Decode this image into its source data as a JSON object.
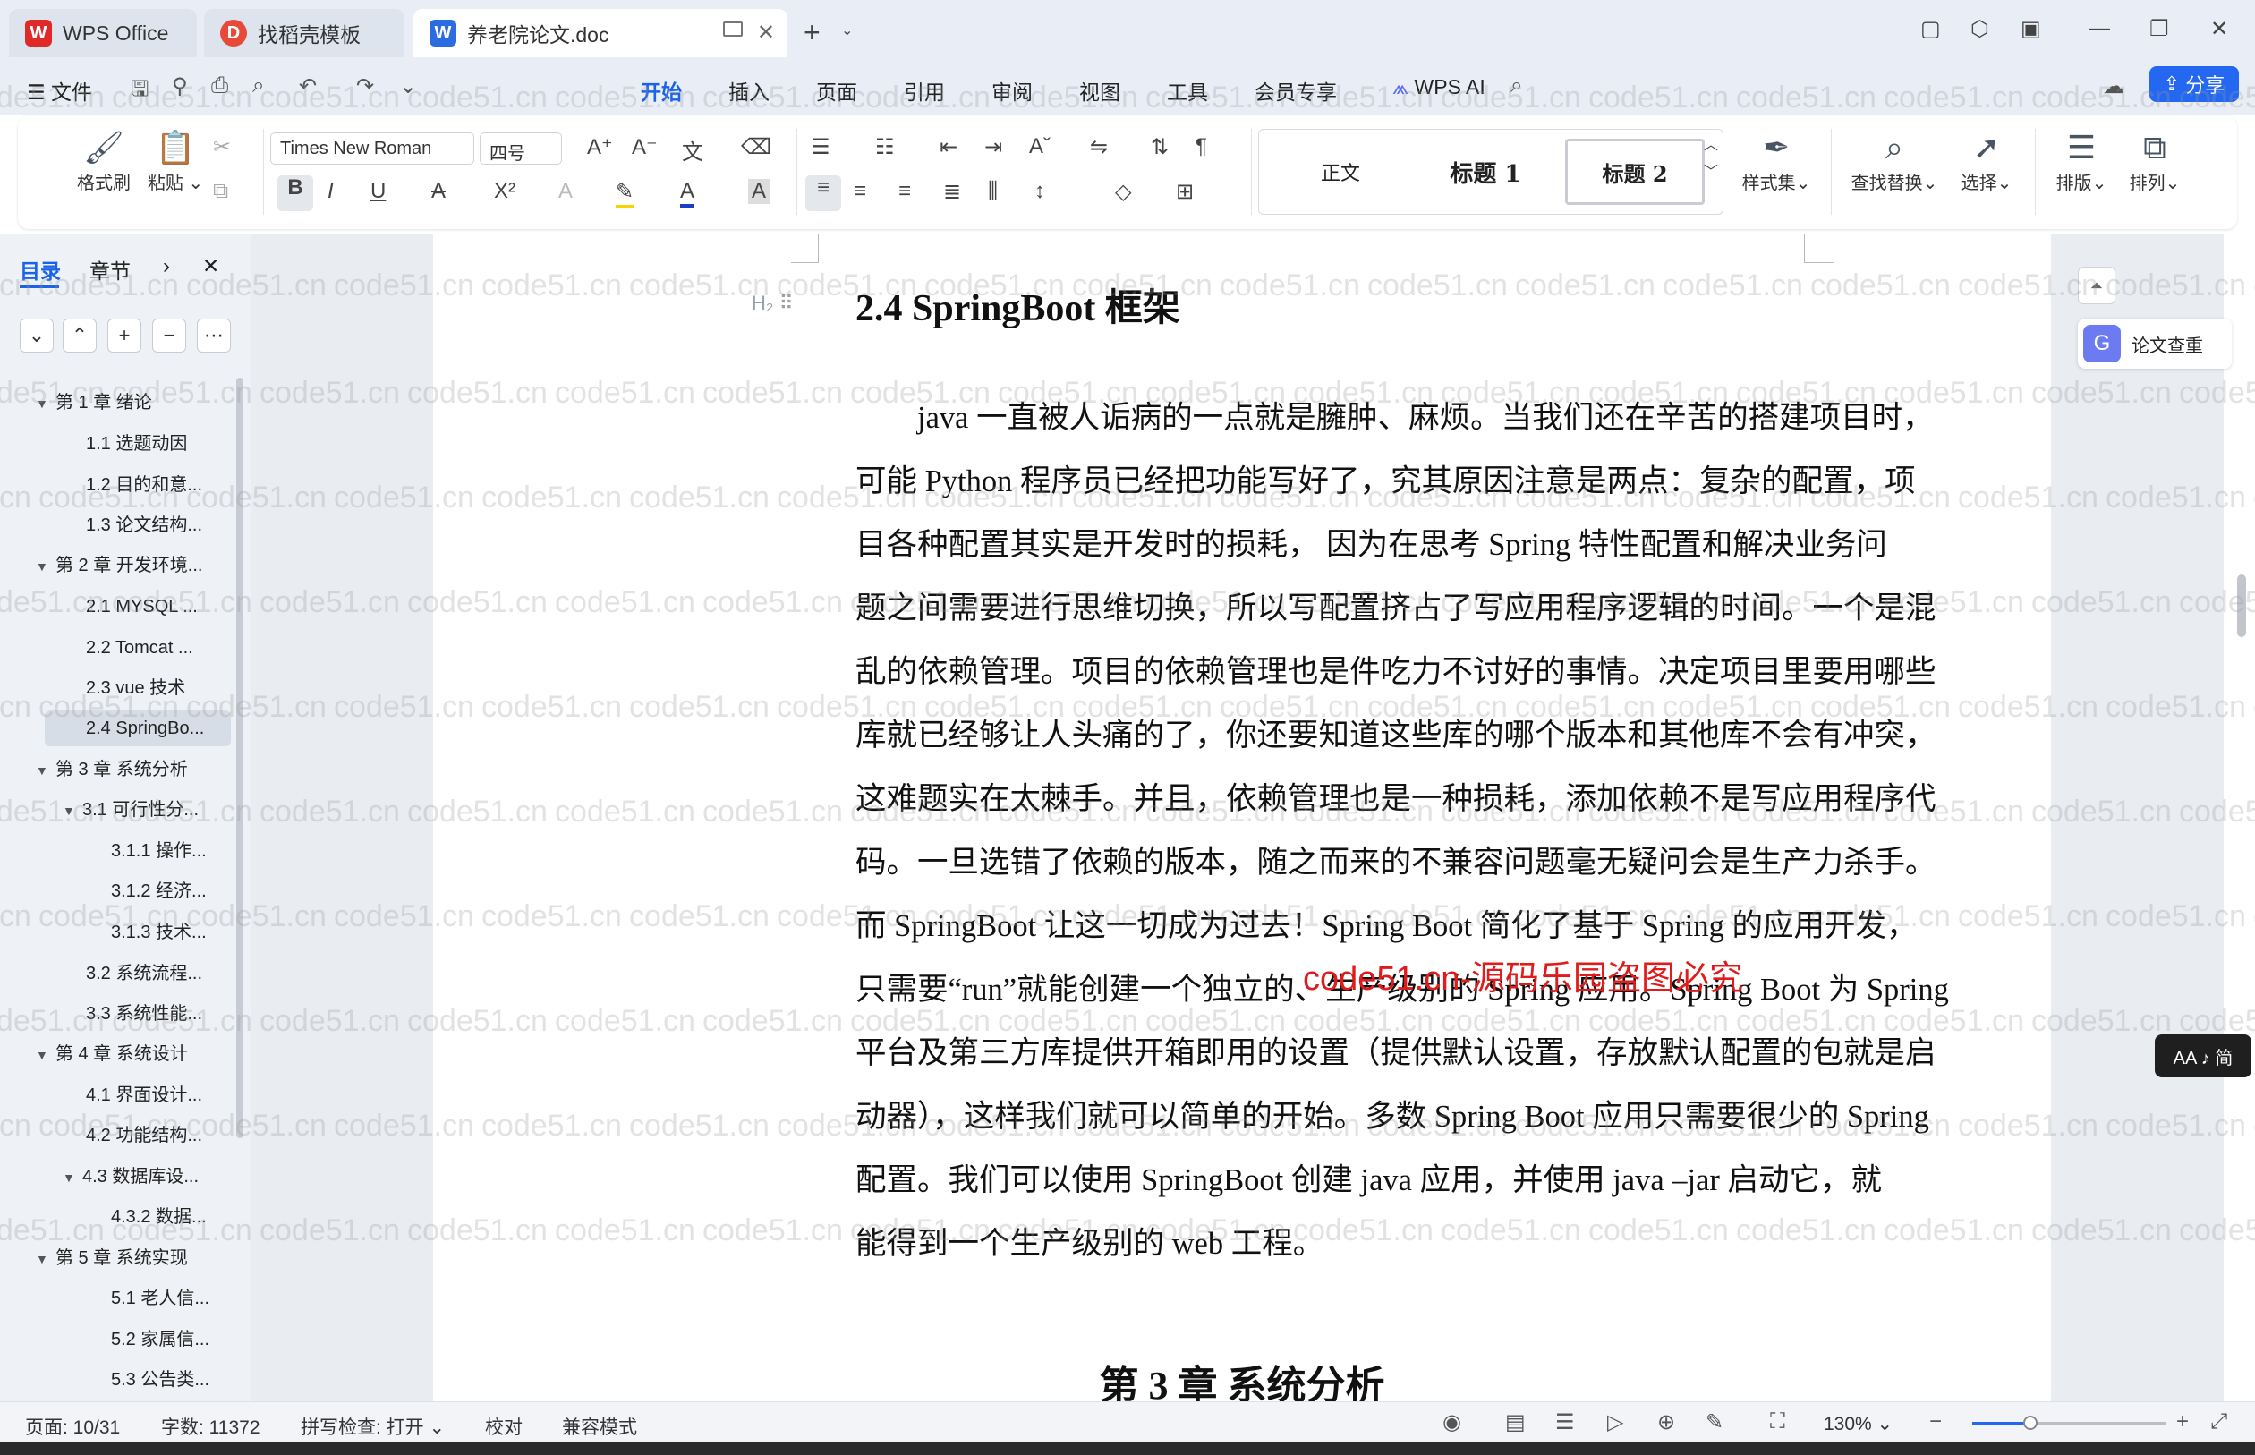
{
  "tabs": [
    {
      "label": "WPS Office",
      "icon": "wps-logo-icon"
    },
    {
      "label": "找稻壳模板",
      "icon": "docer-icon"
    },
    {
      "label": "养老院论文.doc",
      "icon": "word-doc-icon"
    }
  ],
  "menu": {
    "file": "文件",
    "items": [
      "开始",
      "插入",
      "页面",
      "引用",
      "审阅",
      "视图",
      "工具",
      "会员专享"
    ],
    "active": "开始",
    "wps_ai": "WPS AI",
    "share": "分享"
  },
  "ribbon": {
    "format_painter": "格式刷",
    "paste": "粘贴",
    "font_name": "Times New Roman",
    "font_size": "四号",
    "styles": [
      "正文",
      "标题  1",
      "标题  2"
    ],
    "style_set": "样式集",
    "find_replace": "查找替换",
    "select": "选择",
    "typeset": "排版",
    "arrange": "排列",
    "bold": "B",
    "italic": "I",
    "underline": "U",
    "strike": "A",
    "superscript": "X²"
  },
  "left_panel": {
    "tab_toc": "目录",
    "tab_chapter": "章节",
    "toc": [
      {
        "label": "第 1 章  绪论",
        "level": 1,
        "expanded": true
      },
      {
        "label": "1.1 选题动因",
        "level": 2
      },
      {
        "label": "1.2 目的和意...",
        "level": 2
      },
      {
        "label": "1.3 论文结构...",
        "level": 2
      },
      {
        "label": "第 2 章  开发环境...",
        "level": 1,
        "expanded": true
      },
      {
        "label": "2.1 MYSQL ...",
        "level": 2
      },
      {
        "label": "2.2 Tomcat ...",
        "level": 2
      },
      {
        "label": "2.3 vue 技术",
        "level": 2
      },
      {
        "label": "2.4 SpringBo...",
        "level": 2,
        "selected": true
      },
      {
        "label": "第 3 章  系统分析",
        "level": 1,
        "expanded": true
      },
      {
        "label": "3.1 可行性分...",
        "level": 2,
        "expanded": true
      },
      {
        "label": "3.1.1 操作...",
        "level": 3
      },
      {
        "label": "3.1.2 经济...",
        "level": 3
      },
      {
        "label": "3.1.3 技术...",
        "level": 3
      },
      {
        "label": "3.2 系统流程...",
        "level": 2
      },
      {
        "label": "3.3 系统性能...",
        "level": 2
      },
      {
        "label": "第 4 章  系统设计",
        "level": 1,
        "expanded": true
      },
      {
        "label": "4.1 界面设计...",
        "level": 2
      },
      {
        "label": "4.2 功能结构...",
        "level": 2
      },
      {
        "label": "4.3 数据库设...",
        "level": 2,
        "expanded": true
      },
      {
        "label": "4.3.2  数据...",
        "level": 3
      },
      {
        "label": "第 5 章  系统实现",
        "level": 1,
        "expanded": true
      },
      {
        "label": "5.1 老人信...",
        "level": 3
      },
      {
        "label": "5.2  家属信...",
        "level": 3
      },
      {
        "label": "5.3 公告类...",
        "level": 3
      }
    ]
  },
  "document": {
    "heading": "2.4 SpringBoot 框架",
    "lines": [
      "java 一直被人诟病的一点就是臃肿、麻烦。当我们还在辛苦的搭建项目时，",
      "可能 Python 程序员已经把功能写好了，究其原因注意是两点：复杂的配置，项",
      "目各种配置其实是开发时的损耗，  因为在思考 Spring  特性配置和解决业务问",
      "题之间需要进行思维切换，所以写配置挤占了写应用程序逻辑的时间。一个是混",
      "乱的依赖管理。项目的依赖管理也是件吃力不讨好的事情。决定项目里要用哪些",
      "库就已经够让人头痛的了，你还要知道这些库的哪个版本和其他库不会有冲突，",
      "这难题实在太棘手。并且，依赖管理也是一种损耗，添加依赖不是写应用程序代",
      "码。一旦选错了依赖的版本，随之而来的不兼容问题毫无疑问会是生产力杀手。",
      "而 SpringBoot 让这一切成为过去！Spring Boot  简化了基于 Spring 的应用开发，",
      "只需要“run”就能创建一个独立的、生产级别的 Spring 应用。Spring Boot 为 Spring",
      "平台及第三方库提供开箱即用的设置（提供默认设置，存放默认配置的包就是启",
      "动器），这样我们就可以简单的开始。多数 Spring Boot 应用只需要很少的 Spring",
      "配置。我们可以使用 SpringBoot 创建 java 应用，并使用 java  –jar  启动它，就",
      "能得到一个生产级别的 web 工程。"
    ],
    "line_indent_first": true,
    "next_chapter": "第 3 章  系统分析",
    "overlay_text": "code51.cn-源码乐园盗图必究"
  },
  "right_side": {
    "paper_check": "论文查重",
    "aa_badge": "AA ♪ 简"
  },
  "status": {
    "page": "页面: 10/31",
    "words": "字数: 11372",
    "spellcheck": "拼写检查: 打开",
    "proofread": "校对",
    "compat": "兼容模式",
    "zoom": "130%",
    "zoom_fraction": 0.3
  },
  "watermark": "code51.cn",
  "colors": {
    "accent": "#1a62e8",
    "share_bg": "#2468f2",
    "overlay_red": "#e01b1b"
  }
}
